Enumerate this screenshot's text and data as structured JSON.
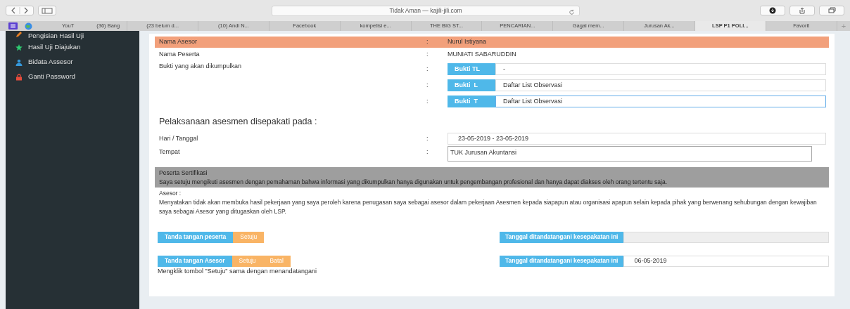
{
  "browser": {
    "address": "Tidak Aman — kajili-jili.com",
    "bookmarks": [
      "YouT",
      "(36) Bang"
    ],
    "tabs": [
      {
        "label": "(23 belum d...",
        "selected": false
      },
      {
        "label": "(10) Andi N...",
        "selected": false
      },
      {
        "label": "Facebook",
        "selected": false
      },
      {
        "label": "kompetisi e...",
        "selected": false
      },
      {
        "label": "THE BIG ST...",
        "selected": false
      },
      {
        "label": "PENCARIAN...",
        "selected": false
      },
      {
        "label": "Gagal mem...",
        "selected": false
      },
      {
        "label": "Jurusan Ak...",
        "selected": false
      },
      {
        "label": "LSP P1 POLI...",
        "selected": true
      },
      {
        "label": "Favorit",
        "selected": false
      }
    ],
    "new_tab": "+"
  },
  "sidebar": {
    "items": [
      {
        "label": "Pengisian Hasil Uji",
        "kind": "pencil",
        "color": "#e67e22"
      },
      {
        "label": "Hasil Uji Diajukan",
        "kind": "star",
        "color": "#2ecc71"
      },
      {
        "label": "Bidata Assesor",
        "kind": "user",
        "color": "#3498db"
      },
      {
        "label": "Ganti Password",
        "kind": "lock",
        "color": "#e74c3c"
      }
    ]
  },
  "form": {
    "header": {
      "label": "Nama Asesor",
      "separator": ":",
      "value": "Nurul Istiyana"
    },
    "participant": {
      "label": "Nama Peserta",
      "separator": ":",
      "value": "MUNIATI SABARUDDIN"
    },
    "evidence": {
      "label": "Bukti yang akan dikumpulkan",
      "items": [
        {
          "separator": ":",
          "addon": "Bukti TL",
          "value": "-",
          "focused": false
        },
        {
          "separator": ":",
          "addon": "Bukti  L",
          "value": "Daftar List Observasi",
          "focused": false
        },
        {
          "separator": ":",
          "addon": "Bukti  T",
          "value": "Daftar List Observasi",
          "focused": true
        }
      ]
    },
    "section_title": "Pelaksanaan asesmen disepakati pada :",
    "date": {
      "label": "Hari / Tanggal",
      "separator": ":",
      "value": "23-05-2019 - 23-05-2019"
    },
    "place": {
      "label": "Tempat",
      "separator": ":",
      "value": "TUK Jurusan Akuntansi"
    }
  },
  "notices": [
    {
      "kind": "participant",
      "title": "Peserta Sertifikasi",
      "text": "Saya setuju mengikuti asesmen dengan pemahaman bahwa informasi yang dikumpulkan hanya digunakan untuk pengembangan profesional dan hanya dapat diakses oleh orang tertentu saja."
    },
    {
      "kind": "assessor",
      "title": "Asesor :",
      "text": "Menyatakan tidak akan membuka hasil pekerjaan yang saya peroleh karena penugasan saya sebagai asesor dalam pekerjaan Asesmen kepada siapapun atau organisasi apapun selain kepada pihak yang berwenang sehubungan dengan kewajiban saya sebagai Asesor yang ditugaskan oleh LSP."
    }
  ],
  "signatures": [
    {
      "label": "Tanda tangan peserta",
      "buttons": [
        "Setuju"
      ],
      "date_label": "Tanggal ditandatangani kesepakatan ini"
    },
    {
      "label": "Tanda tangan Asesor",
      "buttons": [
        "Setuju",
        "Batal"
      ],
      "note": "Mengklik tombol \"Setuju\" sama dengan menandatangani",
      "date_label": "Tanggal ditandatangani kesepakatan ini",
      "date_value": "06-05-2019"
    }
  ]
}
